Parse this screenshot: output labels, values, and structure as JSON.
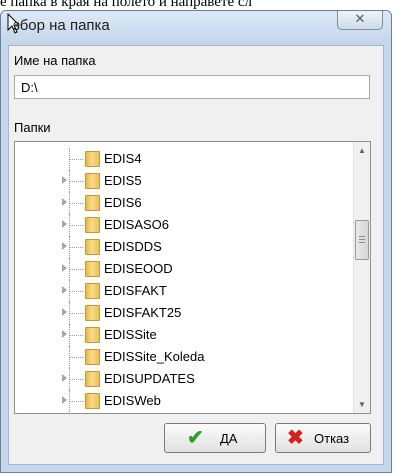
{
  "background_text": "е папка в края на полето и направете сл",
  "dialog": {
    "title": "Избор на папка",
    "title_visible": "збор на папка",
    "close_glyph": "✕"
  },
  "folder_name": {
    "label": "Име на папка",
    "value": "D:\\"
  },
  "folders": {
    "label": "Папки",
    "items": [
      {
        "name": "EDIS4",
        "expandable": false
      },
      {
        "name": "EDIS5",
        "expandable": true
      },
      {
        "name": "EDIS6",
        "expandable": true
      },
      {
        "name": "EDISASO6",
        "expandable": true
      },
      {
        "name": "EDISDDS",
        "expandable": true
      },
      {
        "name": "EDISEOOD",
        "expandable": true
      },
      {
        "name": "EDISFAKT",
        "expandable": true
      },
      {
        "name": "EDISFAKT25",
        "expandable": true
      },
      {
        "name": "EDISSite",
        "expandable": true
      },
      {
        "name": "EDISSite_Koleda",
        "expandable": false
      },
      {
        "name": "EDISUPDATES",
        "expandable": true
      },
      {
        "name": "EDISWeb",
        "expandable": true
      }
    ]
  },
  "buttons": {
    "ok": {
      "label": "ДА",
      "icon": "checkmark-icon",
      "icon_glyph": "✔",
      "color": "#2e9e2e"
    },
    "cancel": {
      "label": "Отказ",
      "icon": "x-icon",
      "icon_glyph": "✖",
      "color": "#d42020"
    }
  },
  "scrollbar": {
    "up_glyph": "▲",
    "down_glyph": "▼"
  }
}
